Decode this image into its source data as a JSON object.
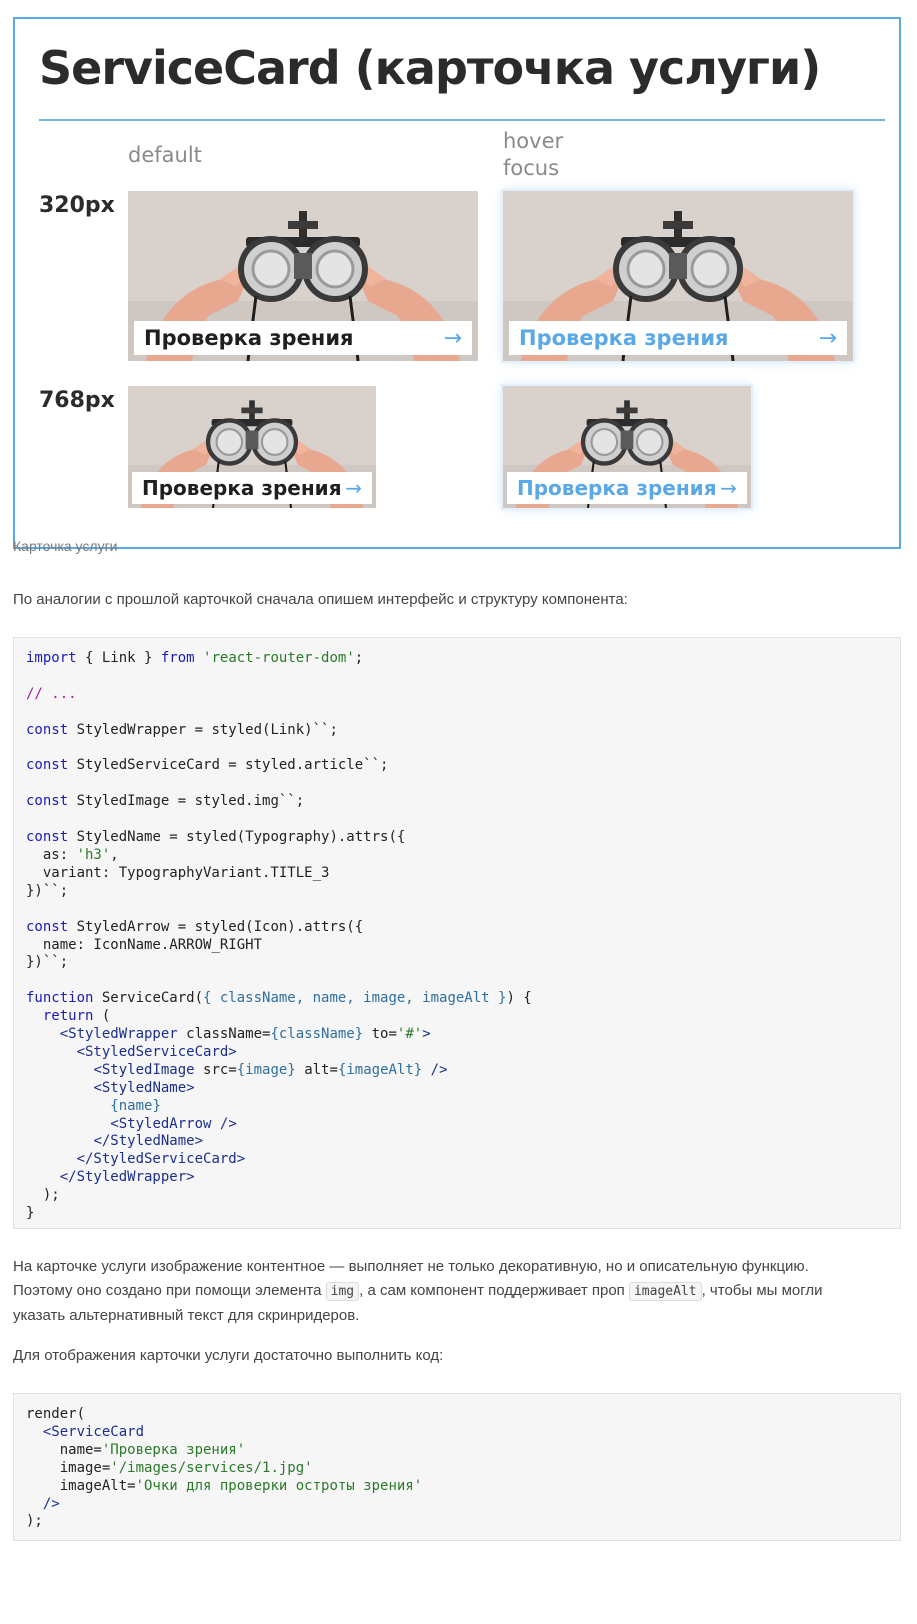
{
  "figure": {
    "title": "ServiceCard (карточка услуги)",
    "states": {
      "default": "default",
      "hover": "hover",
      "focus": "focus"
    },
    "breakpoints": [
      "320px",
      "768px"
    ],
    "card_name": "Проверка зрения",
    "arrow": "→",
    "accent_color": "#5aa9e6"
  },
  "caption": "Карточка услуги",
  "paragraph1": "По аналогии с прошлой карточкой сначала опишем интерфейс и структуру компонента:",
  "code1": [
    "import { Link } from 'react-router-dom';",
    "",
    "// ...",
    "",
    "const StyledWrapper = styled(Link)``;",
    "",
    "const StyledServiceCard = styled.article``;",
    "",
    "const StyledImage = styled.img``;",
    "",
    "const StyledName = styled(Typography).attrs({",
    "  as: 'h3',",
    "  variant: TypographyVariant.TITLE_3",
    "})``;",
    "",
    "const StyledArrow = styled(Icon).attrs({",
    "  name: IconName.ARROW_RIGHT",
    "})``;",
    "",
    "function ServiceCard({ className, name, image, imageAlt }) {",
    "  return (",
    "    <StyledWrapper className={className} to='#'>",
    "      <StyledServiceCard>",
    "        <StyledImage src={image} alt={imageAlt} />",
    "        <StyledName>",
    "          {name}",
    "          <StyledArrow />",
    "        </StyledName>",
    "      </StyledServiceCard>",
    "    </StyledWrapper>",
    "  );",
    "}"
  ],
  "paragraph2": {
    "part1": "На карточке услуги изображение контентное — выполняет не только декоративную, но и описательную функцию.",
    "part2": "Поэтому оно создано при помощи элемента ",
    "code_a": "img",
    "part3": ", а сам компонент поддерживает проп ",
    "code_b": "imageAlt",
    "part4": ", чтобы мы могли",
    "part5": "указать альтернативный текст для скринридеров."
  },
  "paragraph3": "Для отображения карточки услуги достаточно выполнить код:",
  "code2": [
    "render(",
    "  <ServiceCard",
    "    name='Проверка зрения'",
    "    image='/images/services/1.jpg'",
    "    imageAlt='Очки для проверки остроты зрения'",
    "  />",
    ");"
  ]
}
